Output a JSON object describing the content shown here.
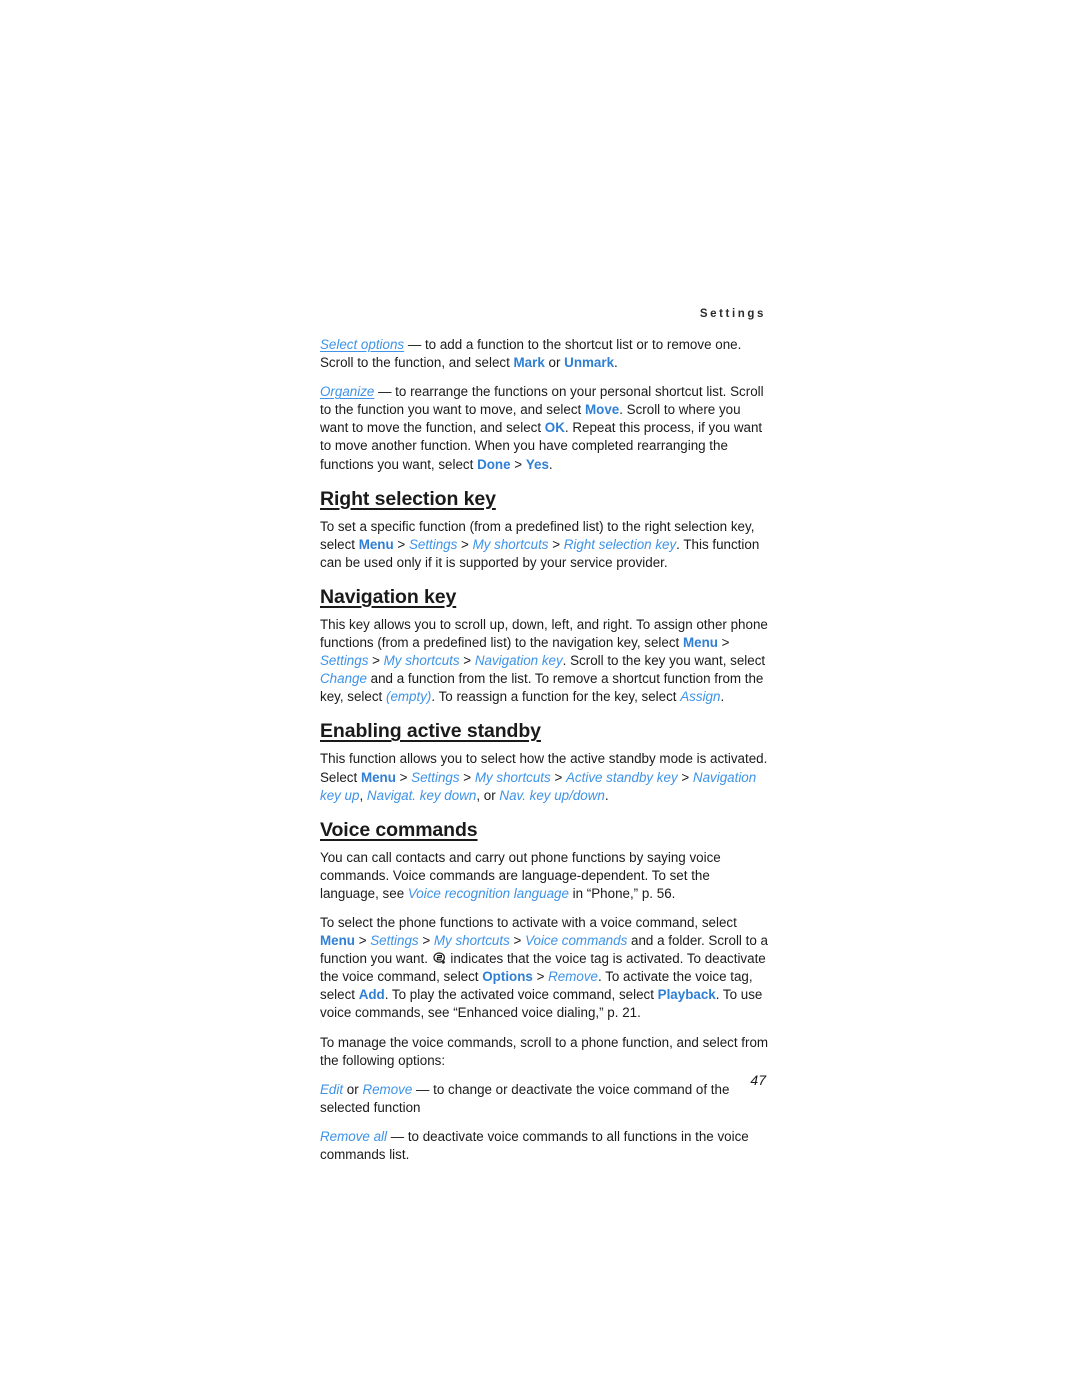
{
  "header": {
    "running_head": "Settings"
  },
  "page_number": "47",
  "icons": {
    "voice_tag": "voice-tag-icon"
  },
  "colors": {
    "link_bold": "#2f7fd4",
    "link_italic": "#3d93e8",
    "body_text": "#1a1a1a",
    "background": "#ffffff"
  },
  "body": {
    "p_select_options": {
      "term": "Select options",
      "t1": " — to add a function to the shortcut list or to remove one. Scroll to the function, and select ",
      "l1": "Mark",
      "t2": " or ",
      "l2": "Unmark",
      "t3": "."
    },
    "p_organize": {
      "term": "Organize",
      "t1": " — to rearrange the functions on your personal shortcut list. Scroll to the function you want to move, and select ",
      "l1": "Move",
      "t2": ". Scroll to where you want to move the function, and select ",
      "l2": "OK",
      "t3": ". Repeat this process, if you want to move another function. When you have completed rearranging the functions you want, select ",
      "l3": "Done",
      "sep1": " > ",
      "l4": "Yes",
      "t4": "."
    },
    "h_right_selection_key": "Right selection key",
    "p_right_selection_key": {
      "t1": "To set a specific function (from a predefined list) to the right selection key, select ",
      "l1": "Menu",
      "sep1": " > ",
      "l2": "Settings",
      "sep2": " > ",
      "l3": "My shortcuts",
      "sep3": " > ",
      "l4": "Right selection key",
      "t2": ". This function can be used only if it is supported by your service provider."
    },
    "h_navigation_key": "Navigation key",
    "p_navigation_key": {
      "t1": "This key allows you to scroll up, down, left, and right. To assign other phone functions (from a predefined list) to the navigation key, select ",
      "l1": "Menu",
      "sep1": " > ",
      "l2": "Settings",
      "sep2": " > ",
      "l3": "My shortcuts",
      "sep3": " > ",
      "l4": "Navigation key",
      "t2": ". Scroll to the key you want, select ",
      "l5": "Change",
      "t3": " and a function from the list. To remove a shortcut function from the key, select ",
      "l6": "(empty)",
      "t4": ". To reassign a function for the key, select ",
      "l7": "Assign",
      "t5": "."
    },
    "h_enabling_active_standby": "Enabling active standby",
    "p_enabling_active_standby": {
      "t1": "This function allows you to select how the active standby mode is activated. Select ",
      "l1": "Menu",
      "sep1": " > ",
      "l2": "Settings",
      "sep2": " > ",
      "l3": "My shortcuts",
      "sep3": " > ",
      "l4": "Active standby key",
      "sep4": " > ",
      "l5": "Navigation key up",
      "t2": ", ",
      "l6": "Navigat. key down",
      "t3": ", or ",
      "l7": "Nav. key up/down",
      "t4": "."
    },
    "h_voice_commands": "Voice commands",
    "p_voice_intro": {
      "t1": "You can call contacts and carry out phone functions by saying voice commands. Voice commands are language-dependent. To set the language, see ",
      "l1": "Voice recognition language",
      "t2": " in “Phone,” p. 56."
    },
    "p_voice_select": {
      "t1": "To select the phone functions to activate with a voice command, select ",
      "l1": "Menu",
      "sep1": " > ",
      "l2": "Settings",
      "sep2": " > ",
      "l3": "My shortcuts",
      "sep3": " > ",
      "l4": "Voice commands",
      "t2": " and a folder. Scroll to a function you want. ",
      "t3": " indicates that the voice tag is activated. To deactivate the voice command, select ",
      "l5": "Options",
      "sep4": " > ",
      "l6": "Remove",
      "t4": ". To activate the voice tag, select ",
      "l7": "Add",
      "t5": ". To play the activated voice command, select ",
      "l8": "Playback",
      "t6": ". To use voice commands, see “Enhanced voice dialing,” p. 21."
    },
    "p_manage": {
      "t1": "To manage the voice commands, scroll to a phone function, and select from the following options:"
    },
    "p_edit_remove": {
      "l1": "Edit",
      "t1": " or ",
      "l2": "Remove",
      "t2": " — to change or deactivate the voice command of the selected function"
    },
    "p_remove_all": {
      "l1": "Remove all",
      "t1": " — to deactivate voice commands to all functions in the voice commands list."
    }
  }
}
